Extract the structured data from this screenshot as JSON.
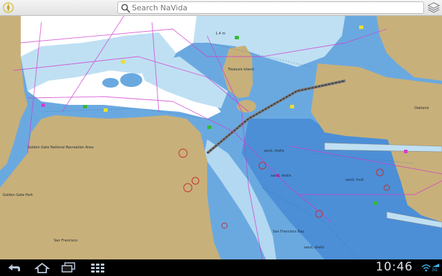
{
  "app": {
    "logo_icon": "compass-logo-icon",
    "search_placeholder": "Search NaVida",
    "layers_icon": "layers-icon"
  },
  "map": {
    "labels": {
      "golden_gate_nra": "Golden Gate National Recreation Area",
      "golden_gate_park": "Golden Gate Park",
      "san_francisco_city": "San Francisco",
      "treasure_island": "Treasure Island",
      "san_francisco_bay": "San Francisco Bay",
      "oakland": "Oakland",
      "sand_shells_1": "sand, shells",
      "sand_shells_2": "sand, shells",
      "sand_shells_3": "sand, shells",
      "sand_mud": "sand, mud",
      "scale_label": "1.4 m"
    },
    "colors": {
      "land": "#c8b07a",
      "deep_water": "#ffffff",
      "shallow_water": "#bfe0f3",
      "medium_water": "#6aa9e0",
      "channel_water": "#4c8fd7",
      "routes": "#d23cd0"
    }
  },
  "system_bar": {
    "back_icon": "back-icon",
    "home_icon": "home-icon",
    "recents_icon": "recent-apps-icon",
    "menu_icon": "grid-menu-icon",
    "time": "10:46",
    "wifi_icon": "wifi-icon",
    "signal_label": "3G"
  }
}
